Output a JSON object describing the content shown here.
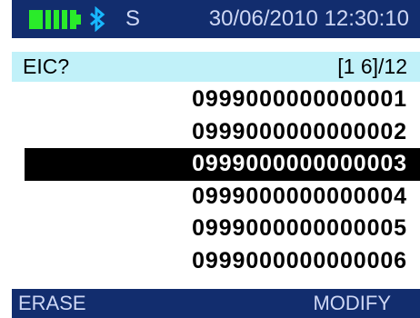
{
  "status": {
    "battery_icon": "battery-full-icon",
    "battery_color": "#2aeb2a",
    "bluetooth_icon": "bluetooth-icon",
    "bluetooth_color": "#18b8ff",
    "mode": "S",
    "datetime": "30/06/2010 12:30:10",
    "bar_color": "#122d6e"
  },
  "header": {
    "prompt": "EIC?",
    "counter": "[1 6]/12",
    "background": "#c1f1f9"
  },
  "list": {
    "items": [
      "0999000000000001",
      "0999000000000002",
      "0999000000000003",
      "0999000000000004",
      "0999000000000005",
      "0999000000000006"
    ],
    "selected_index": 2
  },
  "softkeys": {
    "left": "ERASE",
    "right": "MODIFY"
  }
}
